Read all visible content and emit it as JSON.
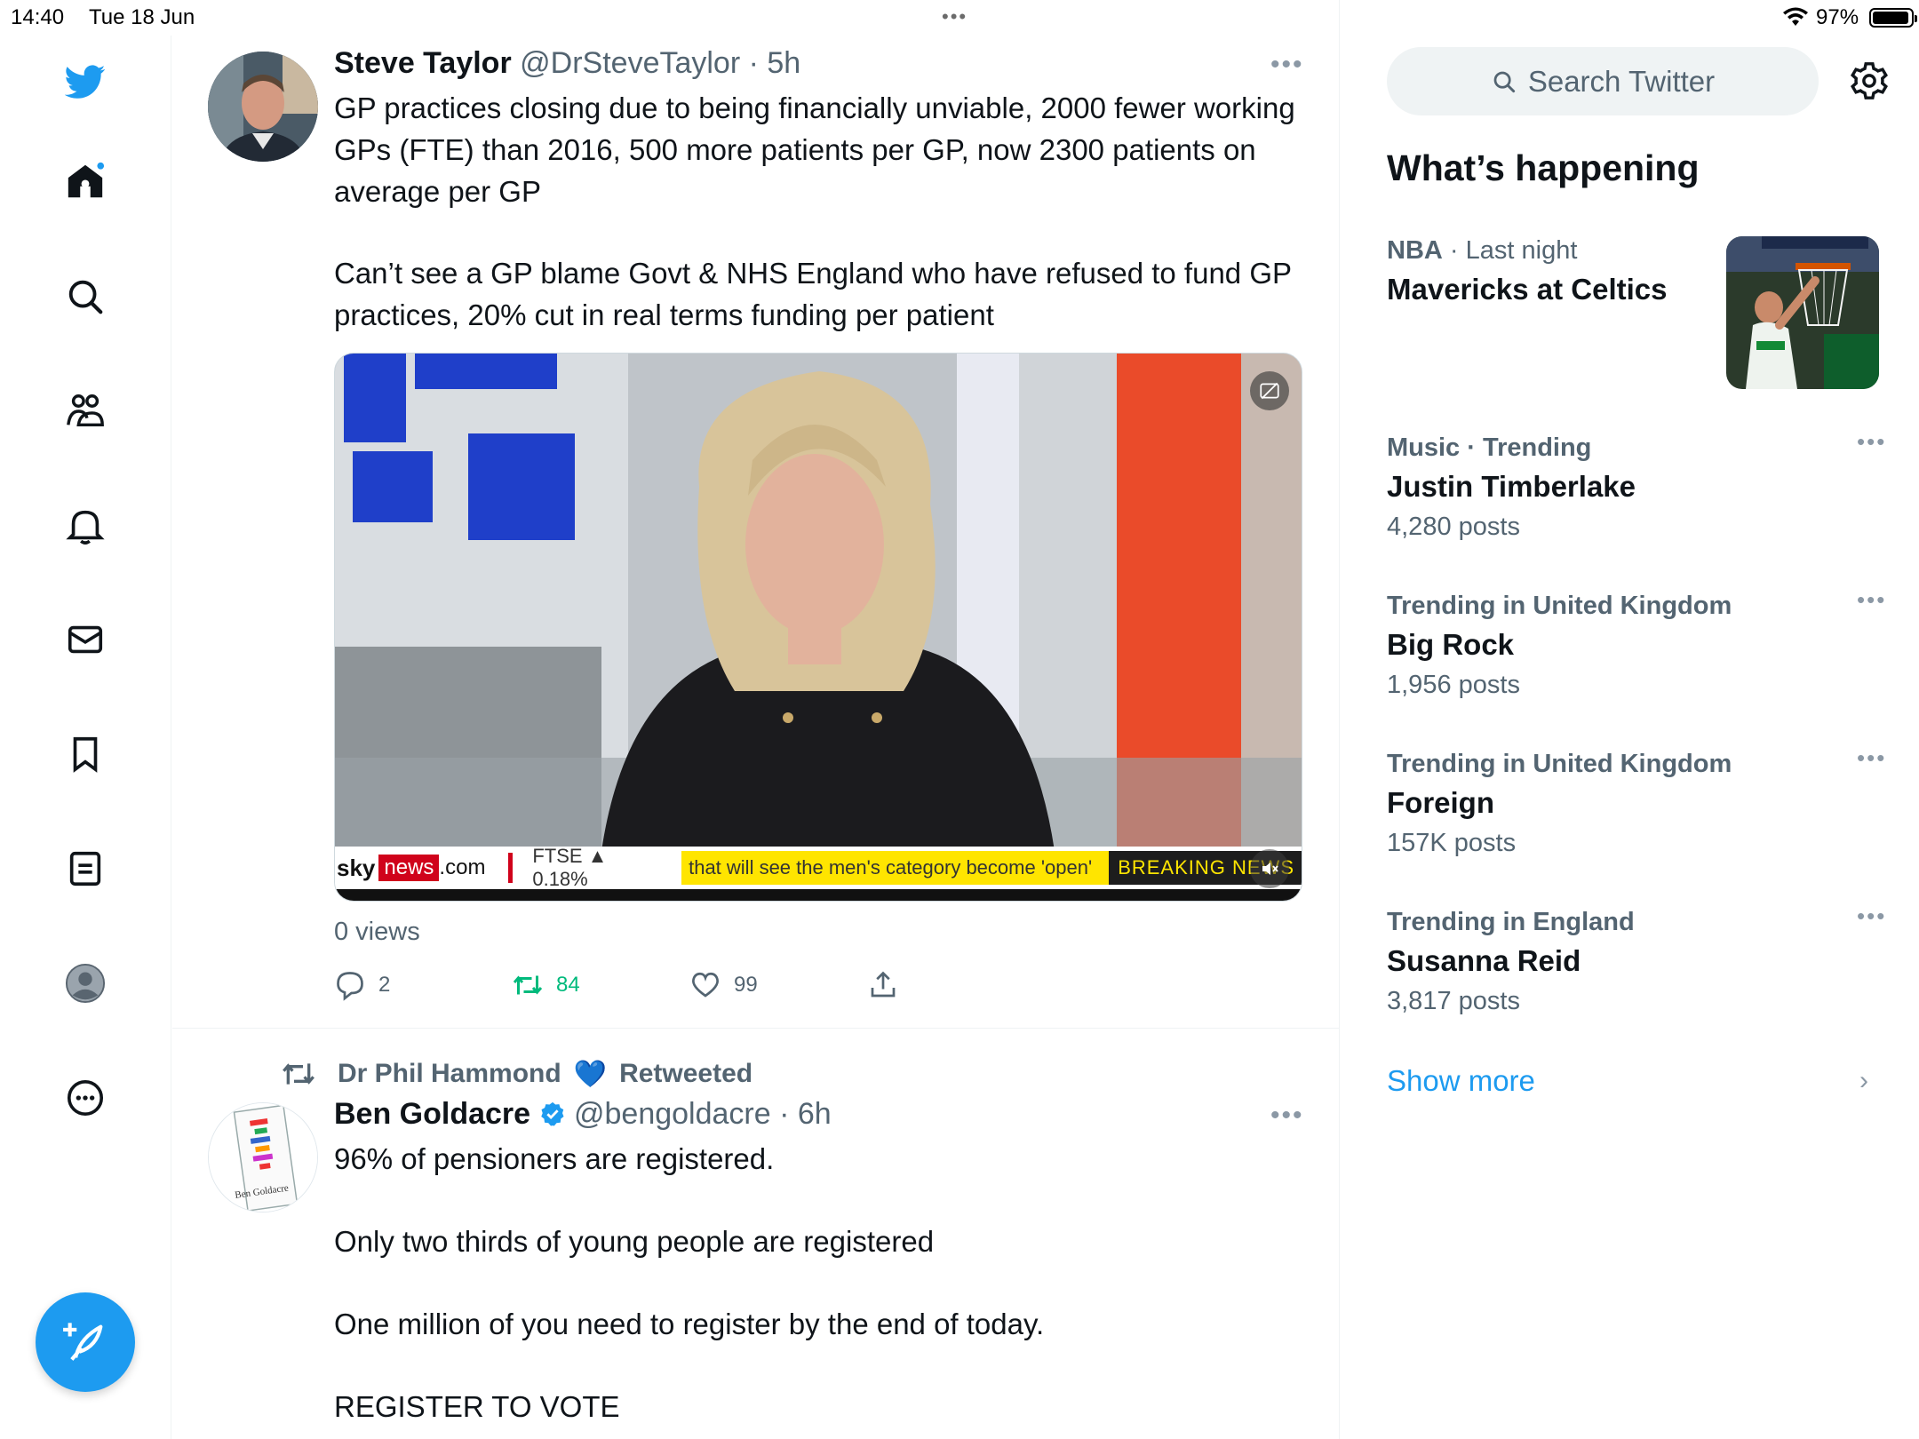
{
  "status_bar": {
    "time": "14:40",
    "date": "Tue 18 Jun",
    "multitask_dots": "•••",
    "battery": "97%"
  },
  "nav": {
    "items": [
      "twitter-logo",
      "home",
      "explore",
      "communities",
      "notifications",
      "messages",
      "bookmarks",
      "lists",
      "profile",
      "more"
    ],
    "compose_label": "Post"
  },
  "tweets": [
    {
      "name": "Steve Taylor",
      "handle": "@DrSteveTaylor",
      "time": "· 5h",
      "more": "•••",
      "text": [
        "GP practices closing due to being financially unviable, 2000 fewer working GPs (FTE) than 2016, 500 more patients per GP, now 2300 patients on average per GP",
        "Can’t see a GP blame Govt & NHS England who  have refused to fund GP practices, 20% cut in real terms funding per patient"
      ],
      "media": {
        "ticker_brand_sky": "sky",
        "ticker_brand_news": "news",
        "ticker_brand_com": ".com",
        "ticker_ftse": "FTSE ▲ 0.18%",
        "ticker_caption": "that will see the men's category become 'open'",
        "ticker_breaking": "BREAKING NEWS"
      },
      "views": "0 views",
      "replies": "2",
      "retweets": "84",
      "likes": "99"
    },
    {
      "retweeted_by": "Dr Phil Hammond",
      "retweeted_heart": "💙",
      "retweeted_label": "Retweeted",
      "name": "Ben Goldacre",
      "handle": "@bengoldacre",
      "time": "· 6h",
      "more": "•••",
      "avatar_caption": "Ben Goldacre",
      "text": [
        "96% of pensioners are registered.",
        "Only two thirds of young people are registered",
        "One million of you need to register by the end of today.",
        "REGISTER TO VOTE"
      ]
    }
  ],
  "sidebar": {
    "search_placeholder": "Search Twitter",
    "heading": "What’s happening",
    "trends": [
      {
        "category": "NBA",
        "meta": "· Last night",
        "title": "Mavericks at Celtics",
        "count": ""
      },
      {
        "category": "Music · Trending",
        "meta": "",
        "title": "Justin Timberlake",
        "count": "4,280 posts"
      },
      {
        "category": "Trending in United Kingdom",
        "meta": "",
        "title": "Big Rock",
        "count": "1,956 posts"
      },
      {
        "category": "Trending in United Kingdom",
        "meta": "",
        "title": "Foreign",
        "count": "157K posts"
      },
      {
        "category": "Trending in England",
        "meta": "",
        "title": "Susanna Reid",
        "count": "3,817 posts"
      }
    ],
    "more_glyph": "•••",
    "show_more": "Show more",
    "chevron": "›"
  },
  "colors": {
    "accent": "#1d9bf0",
    "retweet_green": "#00ba7c",
    "secondary_text": "#536471",
    "primary_text": "#0f1419"
  }
}
